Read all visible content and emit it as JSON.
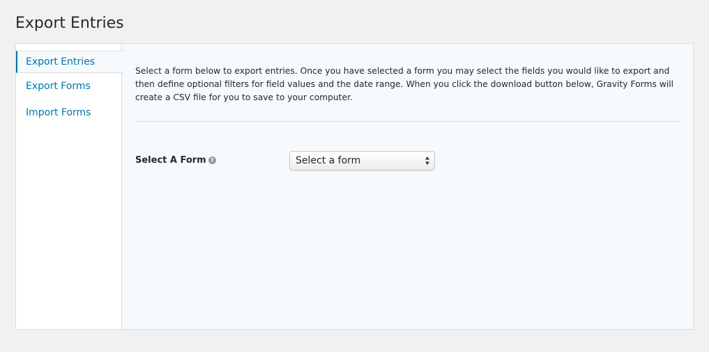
{
  "page": {
    "title": "Export Entries"
  },
  "sidebar": {
    "items": [
      {
        "label": "Export Entries",
        "active": true
      },
      {
        "label": "Export Forms",
        "active": false
      },
      {
        "label": "Import Forms",
        "active": false
      }
    ]
  },
  "main": {
    "description": "Select a form below to export entries. Once you have selected a form you may select the fields you would like to export and then define optional filters for field values and the date range. When you click the download button below, Gravity Forms will create a CSV file for you to save to your computer.",
    "form_select": {
      "label": "Select A Form",
      "help_icon": "question-circle-icon",
      "selected_value": "Select a form"
    }
  },
  "colors": {
    "link": "#0073aa",
    "panel_bg": "#f6fafc",
    "page_bg": "#f1f1f1"
  }
}
